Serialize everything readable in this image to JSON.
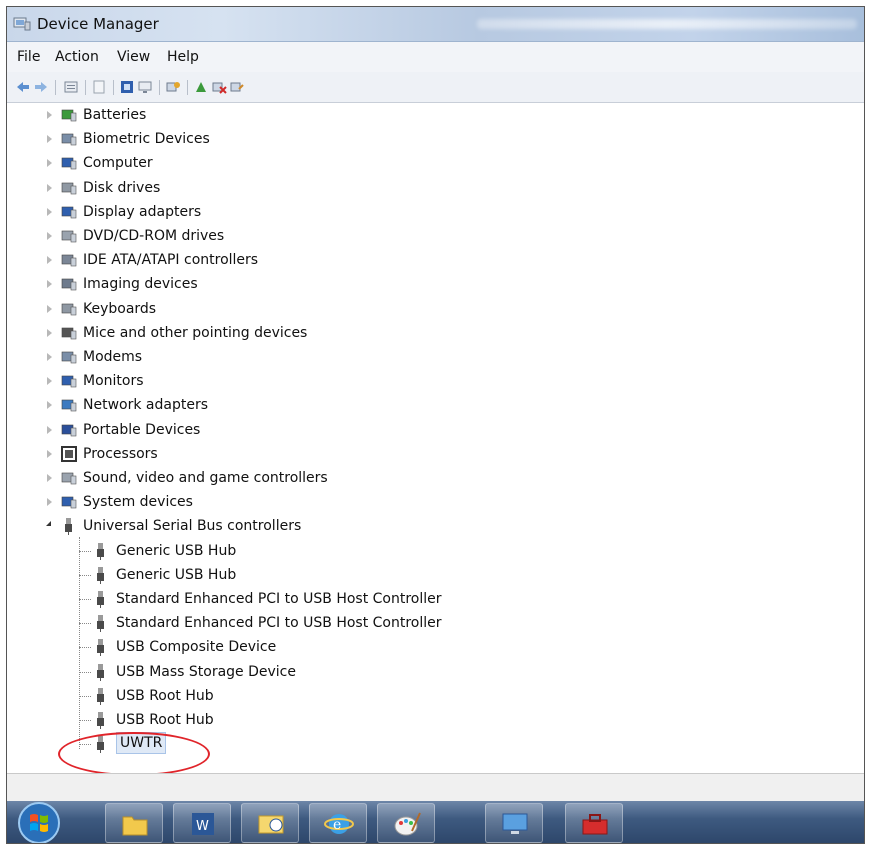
{
  "window": {
    "title": "Device Manager"
  },
  "menu": {
    "items": [
      "File",
      "Action",
      "View",
      "Help"
    ]
  },
  "toolbar": {
    "icons": [
      "back-arrow-icon",
      "forward-arrow-icon",
      "properties-icon",
      "help-page-icon",
      "driver-icon",
      "computer-icon",
      "scan-hardware-icon",
      "update-driver-icon",
      "disable-device-icon",
      "uninstall-icon"
    ]
  },
  "tree": {
    "categories": [
      {
        "label": "Batteries",
        "icon": "battery-icon"
      },
      {
        "label": "Biometric Devices",
        "icon": "biometric-icon"
      },
      {
        "label": "Computer",
        "icon": "computer-icon"
      },
      {
        "label": "Disk drives",
        "icon": "disk-drive-icon"
      },
      {
        "label": "Display adapters",
        "icon": "display-adapter-icon"
      },
      {
        "label": "DVD/CD-ROM drives",
        "icon": "dvd-drive-icon"
      },
      {
        "label": "IDE ATA/ATAPI controllers",
        "icon": "ide-controller-icon"
      },
      {
        "label": "Imaging devices",
        "icon": "camera-icon"
      },
      {
        "label": "Keyboards",
        "icon": "keyboard-icon"
      },
      {
        "label": "Mice and other pointing devices",
        "icon": "mouse-icon"
      },
      {
        "label": "Modems",
        "icon": "modem-icon"
      },
      {
        "label": "Monitors",
        "icon": "monitor-icon"
      },
      {
        "label": "Network adapters",
        "icon": "network-adapter-icon"
      },
      {
        "label": "Portable Devices",
        "icon": "portable-device-icon"
      },
      {
        "label": "Processors",
        "icon": "processor-icon"
      },
      {
        "label": "Sound, video and game controllers",
        "icon": "sound-icon"
      },
      {
        "label": "System devices",
        "icon": "system-device-icon"
      },
      {
        "label": "Universal Serial Bus controllers",
        "icon": "usb-icon",
        "expanded": true
      }
    ],
    "usb_children": [
      "Generic USB Hub",
      "Generic USB Hub",
      "Standard Enhanced PCI to USB Host Controller",
      "Standard Enhanced PCI to USB Host Controller",
      "USB Composite Device",
      "USB Mass Storage Device",
      "USB Root Hub",
      "USB Root Hub",
      "UWTR"
    ],
    "selected": "UWTR"
  },
  "colors": {
    "title_gradient": "#c9d7ea",
    "selection": "#dfe9f6",
    "annotation_ring": "#e0242a",
    "taskbar": "#3e5a80"
  },
  "taskbar": {
    "buttons": [
      "windows-start-orb-icon",
      "file-explorer-icon",
      "word-icon",
      "outlook-icon",
      "internet-explorer-icon",
      "paint-icon",
      "remote-desktop-icon",
      "toolbox-icon"
    ]
  }
}
